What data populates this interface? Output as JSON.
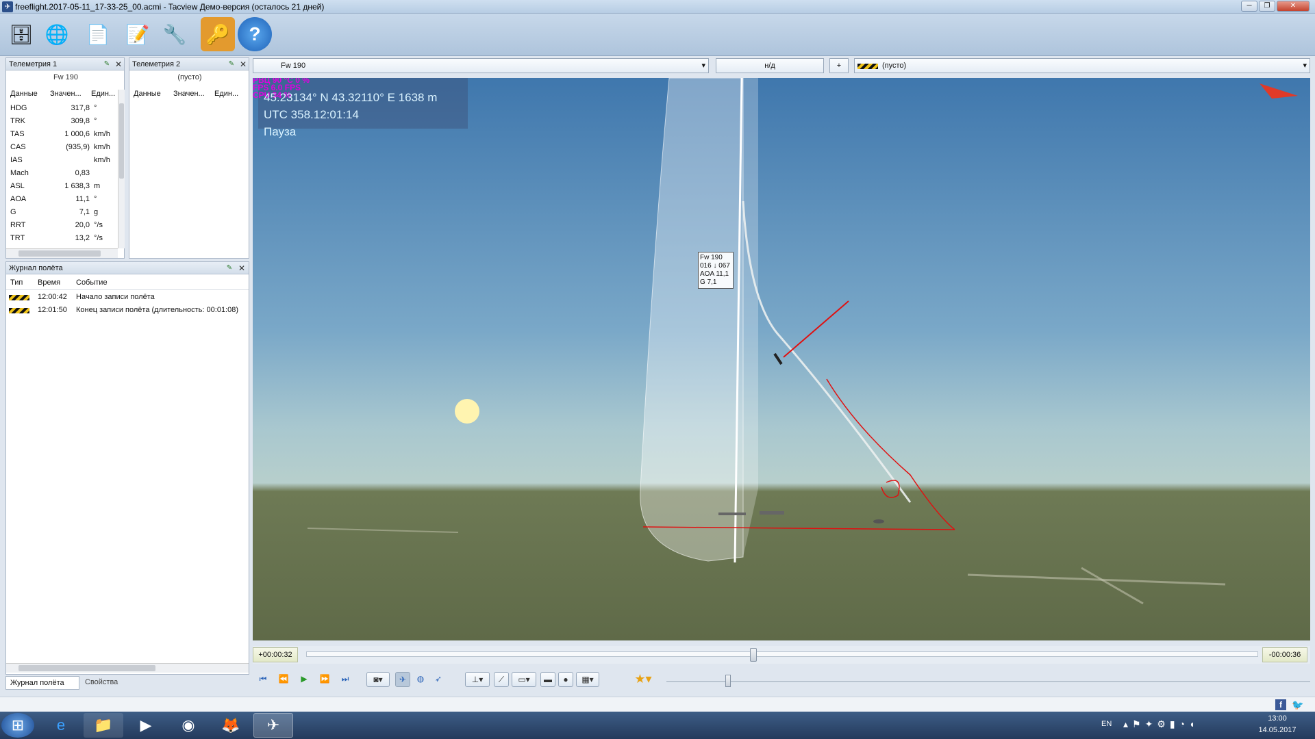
{
  "window": {
    "title": "freeflight.2017-05-11_17-33-25_00.acmi - Tacview Демо-версия (осталось 21 дней)",
    "min": "─",
    "max": "❐",
    "close": "✕"
  },
  "toolbar": {
    "icons": [
      "database-icon",
      "globe-network-icon",
      "documents-icon",
      "edit-document-icon",
      "tools-icon",
      "key-icon",
      "help-icon"
    ]
  },
  "telemetry1": {
    "title": "Телеметрия 1",
    "object": "Fw 190",
    "cols": {
      "name": "Данные",
      "value": "Значен...",
      "unit": "Един..."
    },
    "rows": [
      {
        "name": "HDG",
        "value": "317,8",
        "unit": "°"
      },
      {
        "name": "TRK",
        "value": "309,8",
        "unit": "°"
      },
      {
        "name": "TAS",
        "value": "1 000,6",
        "unit": "km/h"
      },
      {
        "name": "CAS",
        "value": "(935,9)",
        "unit": "km/h"
      },
      {
        "name": "IAS",
        "value": "",
        "unit": "km/h"
      },
      {
        "name": "Mach",
        "value": "0,83",
        "unit": ""
      },
      {
        "name": "ASL",
        "value": "1 638,3",
        "unit": "m"
      },
      {
        "name": "AOA",
        "value": "11,1",
        "unit": "°"
      },
      {
        "name": "G",
        "value": "7,1",
        "unit": "g"
      },
      {
        "name": "RRT",
        "value": "20,0",
        "unit": "°/s"
      },
      {
        "name": "TRT",
        "value": "13,2",
        "unit": "°/s"
      }
    ]
  },
  "telemetry2": {
    "title": "Телеметрия 2",
    "object": "(пусто)",
    "cols": {
      "name": "Данные",
      "value": "Значен...",
      "unit": "Един..."
    }
  },
  "log": {
    "title": "Журнал полёта",
    "cols": {
      "type": "Тип",
      "time": "Время",
      "event": "Событие"
    },
    "rows": [
      {
        "time": "12:00:42",
        "event": "Начало записи полёта"
      },
      {
        "time": "12:01:50",
        "event": "Конец записи полёта (длительность: 00:01:08)"
      }
    ]
  },
  "bottom_tabs": {
    "log": "Журнал полёта",
    "props": "Свойства"
  },
  "view_bar": {
    "primary": "Fw 190",
    "relation": "н/д",
    "plus": "+",
    "secondary": "(пусто)"
  },
  "hud": {
    "coords": "45.23134° N  43.32110° E  1638 m",
    "utc": "UTC 358.12:01:14",
    "status": "Пауза",
    "overlay1": "РВЦ    90 °С    0 %",
    "overlay2": "FPS    6.0 FPS",
    "overlay3": "CPU    34 %"
  },
  "label3d": {
    "name": "Fw 190",
    "line2": "016 ↓ 067",
    "line3": "AOA 11,1",
    "line4": "G 7,1"
  },
  "timeline": {
    "left": "+00:00:32",
    "right": "-00:00:36",
    "progress": 0.47
  },
  "speed_slider": {
    "level": 0.36
  },
  "taskbar": {
    "lang": "EN",
    "time": "13:00",
    "date": "14.05.2017",
    "apps": [
      "start-orb-icon",
      "ie-icon",
      "explorer-icon",
      "media-player-icon",
      "chrome-icon",
      "firefox-icon",
      "tacview-icon"
    ]
  },
  "colors": {
    "annotation": "#e01010",
    "hud_text": "#d9f2ff",
    "magenta": "#e000e0"
  }
}
